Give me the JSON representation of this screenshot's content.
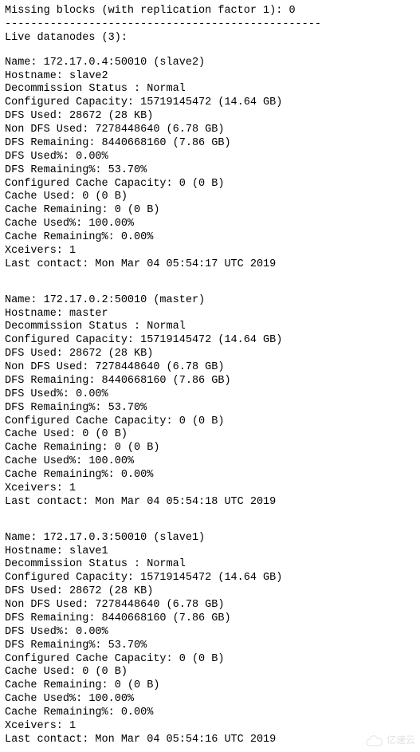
{
  "header": {
    "missing_blocks_line": "Missing blocks (with replication factor 1): 0",
    "divider": "-------------------------------------------------",
    "live_datanodes_line": "Live datanodes (3):"
  },
  "nodes": [
    {
      "name_line": "Name: 172.17.0.4:50010 (slave2)",
      "hostname_line": "Hostname: slave2",
      "decommission_line": "Decommission Status : Normal",
      "configured_capacity_line": "Configured Capacity: 15719145472 (14.64 GB)",
      "dfs_used_line": "DFS Used: 28672 (28 KB)",
      "non_dfs_used_line": "Non DFS Used: 7278448640 (6.78 GB)",
      "dfs_remaining_line": "DFS Remaining: 8440668160 (7.86 GB)",
      "dfs_used_pct_line": "DFS Used%: 0.00%",
      "dfs_remaining_pct_line": "DFS Remaining%: 53.70%",
      "cache_capacity_line": "Configured Cache Capacity: 0 (0 B)",
      "cache_used_line": "Cache Used: 0 (0 B)",
      "cache_remaining_line": "Cache Remaining: 0 (0 B)",
      "cache_used_pct_line": "Cache Used%: 100.00%",
      "cache_remaining_pct_line": "Cache Remaining%: 0.00%",
      "xceivers_line": "Xceivers: 1",
      "last_contact_line": "Last contact: Mon Mar 04 05:54:17 UTC 2019"
    },
    {
      "name_line": "Name: 172.17.0.2:50010 (master)",
      "hostname_line": "Hostname: master",
      "decommission_line": "Decommission Status : Normal",
      "configured_capacity_line": "Configured Capacity: 15719145472 (14.64 GB)",
      "dfs_used_line": "DFS Used: 28672 (28 KB)",
      "non_dfs_used_line": "Non DFS Used: 7278448640 (6.78 GB)",
      "dfs_remaining_line": "DFS Remaining: 8440668160 (7.86 GB)",
      "dfs_used_pct_line": "DFS Used%: 0.00%",
      "dfs_remaining_pct_line": "DFS Remaining%: 53.70%",
      "cache_capacity_line": "Configured Cache Capacity: 0 (0 B)",
      "cache_used_line": "Cache Used: 0 (0 B)",
      "cache_remaining_line": "Cache Remaining: 0 (0 B)",
      "cache_used_pct_line": "Cache Used%: 100.00%",
      "cache_remaining_pct_line": "Cache Remaining%: 0.00%",
      "xceivers_line": "Xceivers: 1",
      "last_contact_line": "Last contact: Mon Mar 04 05:54:18 UTC 2019"
    },
    {
      "name_line": "Name: 172.17.0.3:50010 (slave1)",
      "hostname_line": "Hostname: slave1",
      "decommission_line": "Decommission Status : Normal",
      "configured_capacity_line": "Configured Capacity: 15719145472 (14.64 GB)",
      "dfs_used_line": "DFS Used: 28672 (28 KB)",
      "non_dfs_used_line": "Non DFS Used: 7278448640 (6.78 GB)",
      "dfs_remaining_line": "DFS Remaining: 8440668160 (7.86 GB)",
      "dfs_used_pct_line": "DFS Used%: 0.00%",
      "dfs_remaining_pct_line": "DFS Remaining%: 53.70%",
      "cache_capacity_line": "Configured Cache Capacity: 0 (0 B)",
      "cache_used_line": "Cache Used: 0 (0 B)",
      "cache_remaining_line": "Cache Remaining: 0 (0 B)",
      "cache_used_pct_line": "Cache Used%: 100.00%",
      "cache_remaining_pct_line": "Cache Remaining%: 0.00%",
      "xceivers_line": "Xceivers: 1",
      "last_contact_line": "Last contact: Mon Mar 04 05:54:16 UTC 2019"
    }
  ],
  "watermark": {
    "text": "亿速云"
  }
}
